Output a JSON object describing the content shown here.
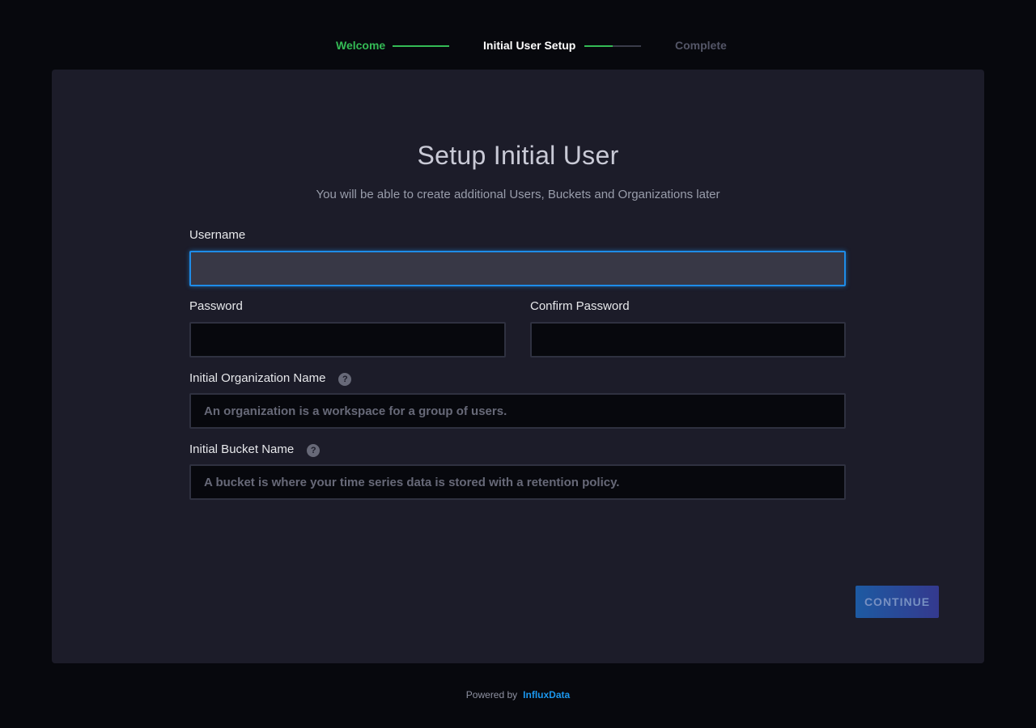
{
  "stepper": {
    "steps": [
      {
        "label": "Welcome",
        "status": "complete"
      },
      {
        "label": "Initial User Setup",
        "status": "current"
      },
      {
        "label": "Complete",
        "status": "pending"
      }
    ],
    "current_progress": 0.5
  },
  "form": {
    "title": "Setup Initial User",
    "subtitle": "You will be able to create additional Users, Buckets and Organizations later",
    "username_label": "Username",
    "username_value": "",
    "password_label": "Password",
    "password_value": "",
    "confirm_password_label": "Confirm Password",
    "confirm_password_value": "",
    "org_label": "Initial Organization Name",
    "org_placeholder": "An organization is a workspace for a group of users.",
    "bucket_label": "Initial Bucket Name",
    "bucket_placeholder": "A bucket is where your time series data is stored with a retention policy.",
    "help_icon_glyph": "?",
    "continue_label": "CONTINUE"
  },
  "footer": {
    "powered_by": "Powered by",
    "brand": "InfluxData"
  },
  "colors": {
    "complete": "#34bb55",
    "accent": "#1e8ce8",
    "brand": "#1b97ee"
  }
}
